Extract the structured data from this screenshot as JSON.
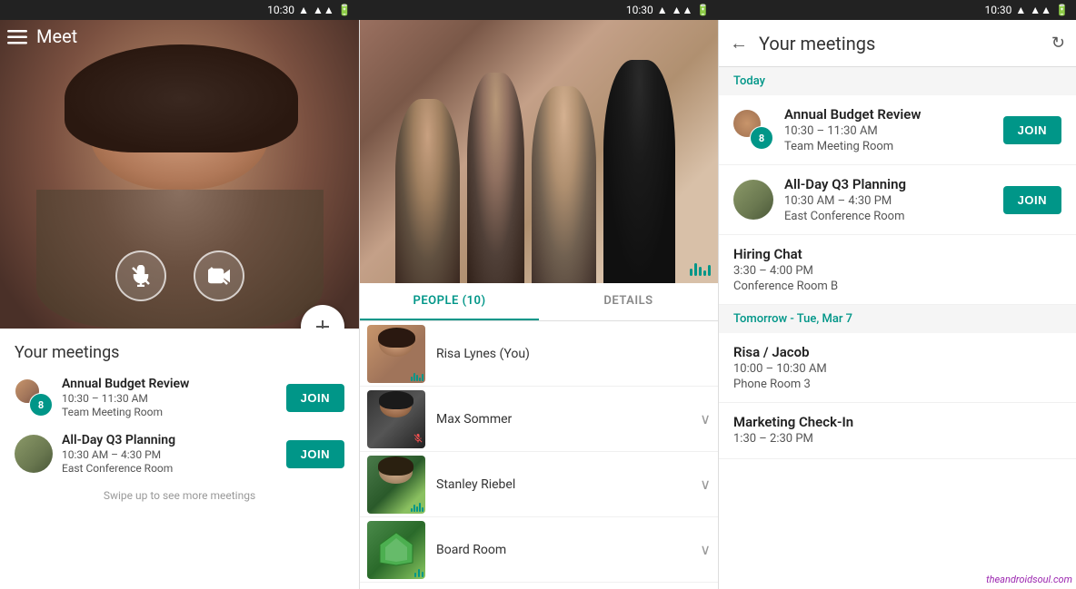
{
  "statusBar": {
    "time": "10:30",
    "icons": [
      "wifi",
      "signal",
      "battery"
    ]
  },
  "panel1": {
    "menuIcon": "☰",
    "title": "Meet",
    "fabIcon": "+",
    "meetingsTitle": "Your meetings",
    "meetings": [
      {
        "name": "Annual Budget Review",
        "time": "10:30 – 11:30 AM",
        "room": "Team Meeting Room",
        "avatarCount": "8",
        "joinLabel": "JOIN"
      },
      {
        "name": "All-Day Q3 Planning",
        "time": "10:30 AM – 4:30 PM",
        "room": "East Conference Room",
        "joinLabel": "JOIN"
      }
    ],
    "swipeHint": "Swipe up to see more meetings"
  },
  "panel2": {
    "tabs": [
      {
        "label": "PEOPLE (10)",
        "active": true
      },
      {
        "label": "DETAILS",
        "active": false
      }
    ],
    "people": [
      {
        "name": "Risa Lynes (You)",
        "hasChevron": false,
        "muted": false
      },
      {
        "name": "Max Sommer",
        "hasChevron": true,
        "muted": true
      },
      {
        "name": "Stanley Riebel",
        "hasChevron": true,
        "muted": false
      },
      {
        "name": "Board Room",
        "hasChevron": true,
        "muted": false
      }
    ]
  },
  "panel3": {
    "backIcon": "←",
    "title": "Your meetings",
    "refreshIcon": "↻",
    "sections": [
      {
        "label": "Today",
        "meetings": [
          {
            "name": "Annual Budget Review",
            "time": "10:30 – 11:30 AM",
            "room": "Team Meeting Room",
            "hasJoin": true,
            "joinLabel": "JOIN"
          },
          {
            "name": "All-Day Q3 Planning",
            "time": "10:30 AM – 4:30 PM",
            "room": "East Conference Room",
            "hasJoin": true,
            "joinLabel": "JOIN"
          },
          {
            "name": "Hiring Chat",
            "time": "3:30 – 4:00 PM",
            "room": "Conference Room B",
            "hasJoin": false
          }
        ]
      },
      {
        "label": "Tomorrow - Tue, Mar 7",
        "meetings": [
          {
            "name": "Risa / Jacob",
            "time": "10:00 – 10:30 AM",
            "room": "Phone Room 3",
            "hasJoin": false
          },
          {
            "name": "Marketing Check-In",
            "time": "1:30 – 2:30 PM",
            "room": "",
            "hasJoin": false
          }
        ]
      }
    ],
    "watermark": "theandroidsoul.com"
  }
}
